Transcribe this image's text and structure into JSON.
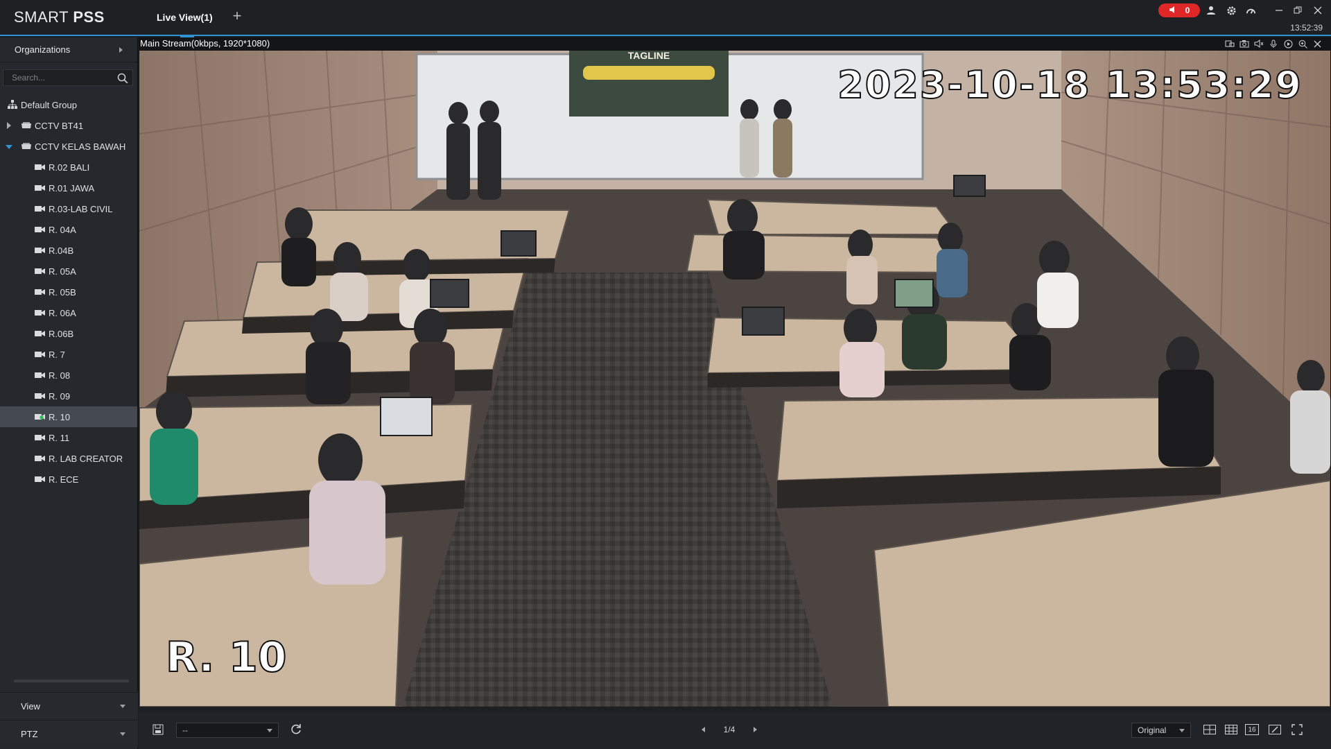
{
  "app": {
    "logo_light": "SMART ",
    "logo_bold": "PSS",
    "tab_label": "Live View(1)",
    "alarm_count": "0",
    "clock": "13:52:39",
    "accent_color": "#2f93d6",
    "alarm_color": "#e02727"
  },
  "sidebar": {
    "header": "Organizations",
    "search_placeholder": "Search...",
    "groups": {
      "root": "Default Group",
      "g1": "CCTV BT41",
      "g2": "CCTV KELAS BAWAH"
    },
    "cameras": [
      "R.02 BALI",
      "R.01 JAWA",
      "R.03-LAB CIVIL",
      "R. 04A",
      "R.04B",
      "R. 05A",
      "R. 05B",
      "R. 06A",
      "R.06B",
      "R. 7",
      "R. 08",
      "R. 09",
      "R. 10",
      "R. 11",
      "R. LAB CREATOR",
      "R. ECE"
    ],
    "selected_camera": "R. 10",
    "view_label": "View",
    "ptz_label": "PTZ"
  },
  "video": {
    "stream_label": "Main Stream(0kbps, 1920*1080)",
    "timestamp_overlay": "2023-10-18 13:53:29",
    "camera_name_overlay": "R. 10",
    "whiteboard_text": "TAGLINE"
  },
  "bottombar": {
    "view_select": "--",
    "page": "1/4",
    "ratio_select": "Original",
    "layout_16": "16"
  }
}
